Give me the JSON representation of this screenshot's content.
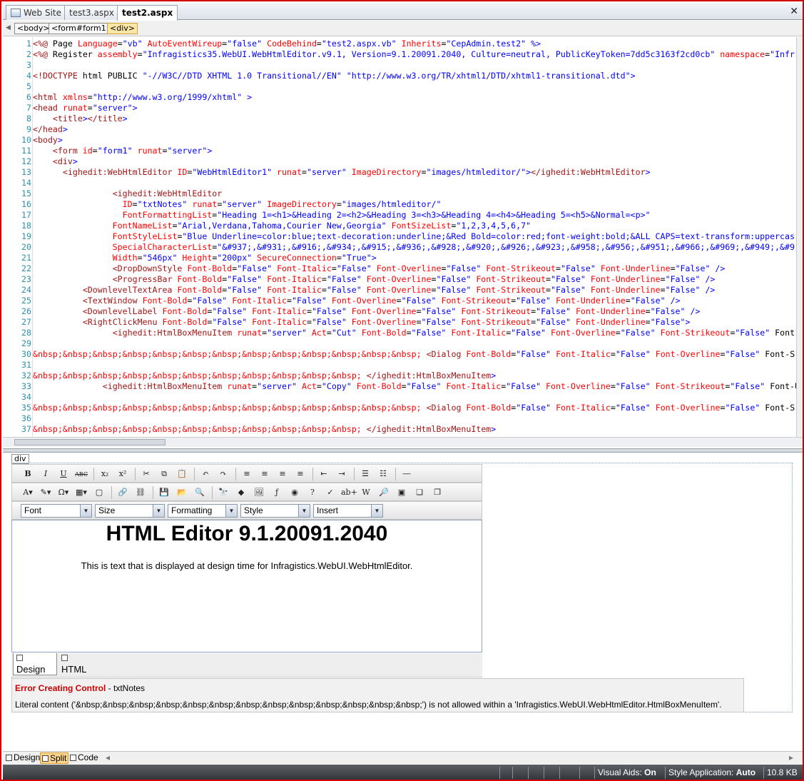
{
  "tabs": [
    {
      "label": "Web Site",
      "active": false
    },
    {
      "label": "test3.aspx",
      "active": false
    },
    {
      "label": "test2.aspx",
      "active": true
    }
  ],
  "close_glyph": "✕",
  "breadcrumb": [
    "<body>",
    "<form#form1>",
    "<div>"
  ],
  "code_lines": [
    {
      "n": "1",
      "t": "<%@ Page Language=\"vb\" AutoEventWireup=\"false\" CodeBehind=\"test2.aspx.vb\" Inherits=\"CepAdmin.test2\" %>"
    },
    {
      "n": "2",
      "t": "<%@ Register assembly=\"Infragistics35.WebUI.WebHtmlEditor.v9.1, Version=9.1.20091.2040, Culture=neutral, PublicKeyToken=7dd5c3163f2cd0cb\" namespace=\"Infr"
    },
    {
      "n": "3",
      "t": ""
    },
    {
      "n": "4",
      "t": "<!DOCTYPE html PUBLIC \"-//W3C//DTD XHTML 1.0 Transitional//EN\" \"http://www.w3.org/TR/xhtml1/DTD/xhtml1-transitional.dtd\">"
    },
    {
      "n": "5",
      "t": ""
    },
    {
      "n": "6",
      "t": "<html xmlns=\"http://www.w3.org/1999/xhtml\" >"
    },
    {
      "n": "7",
      "t": "<head runat=\"server\">"
    },
    {
      "n": "8",
      "t": "    <title></title>"
    },
    {
      "n": "9",
      "t": "</head>"
    },
    {
      "n": "10",
      "t": "<body>"
    },
    {
      "n": "11",
      "t": "    <form id=\"form1\" runat=\"server\">"
    },
    {
      "n": "12",
      "t": "    <div>"
    },
    {
      "n": "13",
      "t": "      <ighedit:WebHtmlEditor ID=\"WebHtmlEditor1\" runat=\"server\" ImageDirectory=\"images/htmleditor/\"></ighedit:WebHtmlEditor>"
    },
    {
      "n": "14",
      "t": ""
    },
    {
      "n": "15",
      "t": "                <ighedit:WebHtmlEditor"
    },
    {
      "n": "16",
      "t": "                  ID=\"txtNotes\" runat=\"server\" ImageDirectory=\"images/htmleditor/\""
    },
    {
      "n": "17",
      "t": "                  FontFormattingList=\"Heading 1=<h1>&Heading 2=<h2>&Heading 3=<h3>&Heading 4=<h4>&Heading 5=<h5>&Normal=<p>\""
    },
    {
      "n": "18",
      "t": "                FontNameList=\"Arial,Verdana,Tahoma,Courier New,Georgia\" FontSizeList=\"1,2,3,4,5,6,7\""
    },
    {
      "n": "19",
      "t": "                FontStyleList=\"Blue Underline=color:blue;text-decoration:underline;&Red Bold=color:red;font-weight:bold;&ALL CAPS=text-transform:uppercas"
    },
    {
      "n": "20",
      "t": "                SpecialCharacterList=\"&#937;,&#931;,&#916;,&#934;,&#915;,&#936;,&#928;,&#920;,&#926;,&#923;,&#958;,&#956;,&#951;,&#966;,&#969;,&#949;,&#9"
    },
    {
      "n": "21",
      "t": "                Width=\"546px\" Height=\"200px\" SecureConnection=\"True\">"
    },
    {
      "n": "22",
      "t": "                <DropDownStyle Font-Bold=\"False\" Font-Italic=\"False\" Font-Overline=\"False\" Font-Strikeout=\"False\" Font-Underline=\"False\" />"
    },
    {
      "n": "23",
      "t": "                <ProgressBar Font-Bold=\"False\" Font-Italic=\"False\" Font-Overline=\"False\" Font-Strikeout=\"False\" Font-Underline=\"False\" />"
    },
    {
      "n": "24",
      "t": "          <DownlevelTextArea Font-Bold=\"False\" Font-Italic=\"False\" Font-Overline=\"False\" Font-Strikeout=\"False\" Font-Underline=\"False\" />"
    },
    {
      "n": "25",
      "t": "          <TextWindow Font-Bold=\"False\" Font-Italic=\"False\" Font-Overline=\"False\" Font-Strikeout=\"False\" Font-Underline=\"False\" />"
    },
    {
      "n": "26",
      "t": "          <DownlevelLabel Font-Bold=\"False\" Font-Italic=\"False\" Font-Overline=\"False\" Font-Strikeout=\"False\" Font-Underline=\"False\" />"
    },
    {
      "n": "27",
      "t": "          <RightClickMenu Font-Bold=\"False\" Font-Italic=\"False\" Font-Overline=\"False\" Font-Strikeout=\"False\" Font-Underline=\"False\">"
    },
    {
      "n": "28",
      "t": "                <ighedit:HtmlBoxMenuItem runat=\"server\" Act=\"Cut\" Font-Bold=\"False\" Font-Italic=\"False\" Font-Overline=\"False\" Font-Strikeout=\"False\" Font"
    },
    {
      "n": "29",
      "t": ""
    },
    {
      "n": "30",
      "t": "&nbsp;&nbsp;&nbsp;&nbsp;&nbsp;&nbsp;&nbsp;&nbsp;&nbsp;&nbsp;&nbsp;&nbsp;&nbsp; <Dialog Font-Bold=\"False\" Font-Italic=\"False\" Font-Overline=\"False\" Font-S"
    },
    {
      "n": "31",
      "t": ""
    },
    {
      "n": "32",
      "t": "&nbsp;&nbsp;&nbsp;&nbsp;&nbsp;&nbsp;&nbsp;&nbsp;&nbsp;&nbsp;&nbsp; </ighedit:HtmlBoxMenuItem>"
    },
    {
      "n": "33",
      "t": "              <ighedit:HtmlBoxMenuItem runat=\"server\" Act=\"Copy\" Font-Bold=\"False\" Font-Italic=\"False\" Font-Overline=\"False\" Font-Strikeout=\"False\" Font-Un"
    },
    {
      "n": "34",
      "t": ""
    },
    {
      "n": "35",
      "t": "&nbsp;&nbsp;&nbsp;&nbsp;&nbsp;&nbsp;&nbsp;&nbsp;&nbsp;&nbsp;&nbsp;&nbsp;&nbsp; <Dialog Font-Bold=\"False\" Font-Italic=\"False\" Font-Overline=\"False\" Font-S"
    },
    {
      "n": "36",
      "t": ""
    },
    {
      "n": "37",
      "t": "&nbsp;&nbsp;&nbsp;&nbsp;&nbsp;&nbsp;&nbsp;&nbsp;&nbsp;&nbsp;&nbsp; </ighedit:HtmlBoxMenuItem>"
    }
  ],
  "design": {
    "div_tag": "div",
    "toolbar1": [
      {
        "name": "bold-button",
        "g": "B"
      },
      {
        "name": "italic-button",
        "g": "I"
      },
      {
        "name": "underline-button",
        "g": "U"
      },
      {
        "name": "strikethrough-button",
        "g": "ABC"
      },
      {
        "name": "subscript-button",
        "g": "x₂"
      },
      {
        "name": "superscript-button",
        "g": "x²"
      },
      {
        "name": "cut-button",
        "g": "✂"
      },
      {
        "name": "copy-button",
        "g": "⧉"
      },
      {
        "name": "paste-button",
        "g": "📋"
      },
      {
        "name": "undo-button",
        "g": "↶"
      },
      {
        "name": "redo-button",
        "g": "↷"
      },
      {
        "name": "align-left-button",
        "g": "≡"
      },
      {
        "name": "align-center-button",
        "g": "≡"
      },
      {
        "name": "align-right-button",
        "g": "≡"
      },
      {
        "name": "justify-button",
        "g": "≡"
      },
      {
        "name": "outdent-button",
        "g": "⇤"
      },
      {
        "name": "indent-button",
        "g": "⇥"
      },
      {
        "name": "bullet-list-button",
        "g": "☰"
      },
      {
        "name": "numbered-list-button",
        "g": "☷"
      },
      {
        "name": "horizontal-rule-button",
        "g": "―"
      }
    ],
    "toolbar2": [
      {
        "name": "font-color-button",
        "g": "A▾"
      },
      {
        "name": "highlight-button",
        "g": "✎▾"
      },
      {
        "name": "special-char-button",
        "g": "Ω▾"
      },
      {
        "name": "table-button",
        "g": "▦▾"
      },
      {
        "name": "box-button",
        "g": "▢"
      },
      {
        "name": "insert-link-button",
        "g": "🔗"
      },
      {
        "name": "remove-link-button",
        "g": "⛓"
      },
      {
        "name": "save-button",
        "g": "💾"
      },
      {
        "name": "open-button",
        "g": "📂"
      },
      {
        "name": "preview-button",
        "g": "🔍"
      },
      {
        "name": "find-button",
        "g": "🔭"
      },
      {
        "name": "clean-button",
        "g": "◆"
      },
      {
        "name": "insert-image-button",
        "g": "🖼"
      },
      {
        "name": "flash-button",
        "g": "ƒ"
      },
      {
        "name": "media-button",
        "g": "◉"
      },
      {
        "name": "help-button",
        "g": "?"
      },
      {
        "name": "spellcheck-button",
        "g": "✓"
      },
      {
        "name": "word-count-button",
        "g": "ab+"
      },
      {
        "name": "paste-word-button",
        "g": "W"
      },
      {
        "name": "zoom-button",
        "g": "🔎"
      },
      {
        "name": "layer-button",
        "g": "▣"
      },
      {
        "name": "bring-forward-button",
        "g": "❏"
      },
      {
        "name": "send-backward-button",
        "g": "❐"
      }
    ],
    "dropdowns": [
      "Font",
      "Size",
      "Formatting",
      "Style",
      "Insert"
    ],
    "heading": "HTML Editor 9.1.20091.2040",
    "paragraph": "This is text that is displayed at design time for Infragistics.WebUI.WebHtmlEditor.",
    "mode_tabs": [
      "Design",
      "HTML"
    ],
    "error_title": "Error Creating Control",
    "error_subject": " - txtNotes",
    "error_message": "Literal content ('&nbsp;&nbsp;&nbsp;&nbsp;&nbsp;&nbsp;&nbsp;&nbsp;&nbsp;&nbsp;&nbsp;&nbsp;&nbsp;') is not allowed within a 'Infragistics.WebUI.WebHtmlEditor.HtmlBoxMenuItem'."
  },
  "view_buttons": [
    {
      "label": "Design",
      "active": false
    },
    {
      "label": "Split",
      "active": true
    },
    {
      "label": "Code",
      "active": false
    }
  ],
  "status": {
    "visual_aids_label": "Visual Aids:",
    "visual_aids_value": "On",
    "style_app_label": "Style Application:",
    "style_app_value": "Auto",
    "size": "10.8 KB"
  },
  "colors": {
    "frame_border": "#d40000",
    "tag": "#a31515",
    "attr": "#ff0000",
    "value": "#0000ff",
    "text": "#000000",
    "line_number": "#2b91af",
    "error_title": "#cc0000"
  }
}
